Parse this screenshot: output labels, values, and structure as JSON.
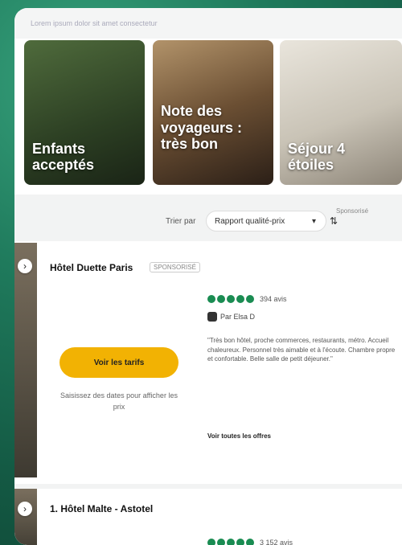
{
  "header": {
    "text": "Lorem ipsum dolor sit amet consectetur"
  },
  "tiles": [
    {
      "label": "Enfants acceptés"
    },
    {
      "label": "Note des voyageurs : très bon"
    },
    {
      "label": "Séjour 4 étoiles"
    }
  ],
  "sort": {
    "label": "Trier par",
    "selected": "Rapport qualité-prix",
    "sponsored_note": "Sponsorisé"
  },
  "listings": [
    {
      "name": "Hôtel Duette Paris",
      "sponsor_tag": "SPONSORISÉ",
      "rating_count": "394 avis",
      "review_author": "Par Elsa D",
      "review_text": "\"Très bon hôtel, proche commerces, restaurants, métro. Accueil chaleureux. Personnel très aimable et à l'écoute. Chambre propre et confortable. Belle salle de petit déjeuner.\"",
      "review_more": "Voir toutes les offres",
      "cta": "Voir les tarifs",
      "date_hint": "Saisissez des dates pour afficher les prix",
      "bubbles": 5
    },
    {
      "name": "1. Hôtel Malte - Astotel",
      "rating_count": "3 152 avis",
      "bubbles": 5
    }
  ],
  "colors": {
    "accent": "#f2b203",
    "rating": "#1a8c52"
  }
}
